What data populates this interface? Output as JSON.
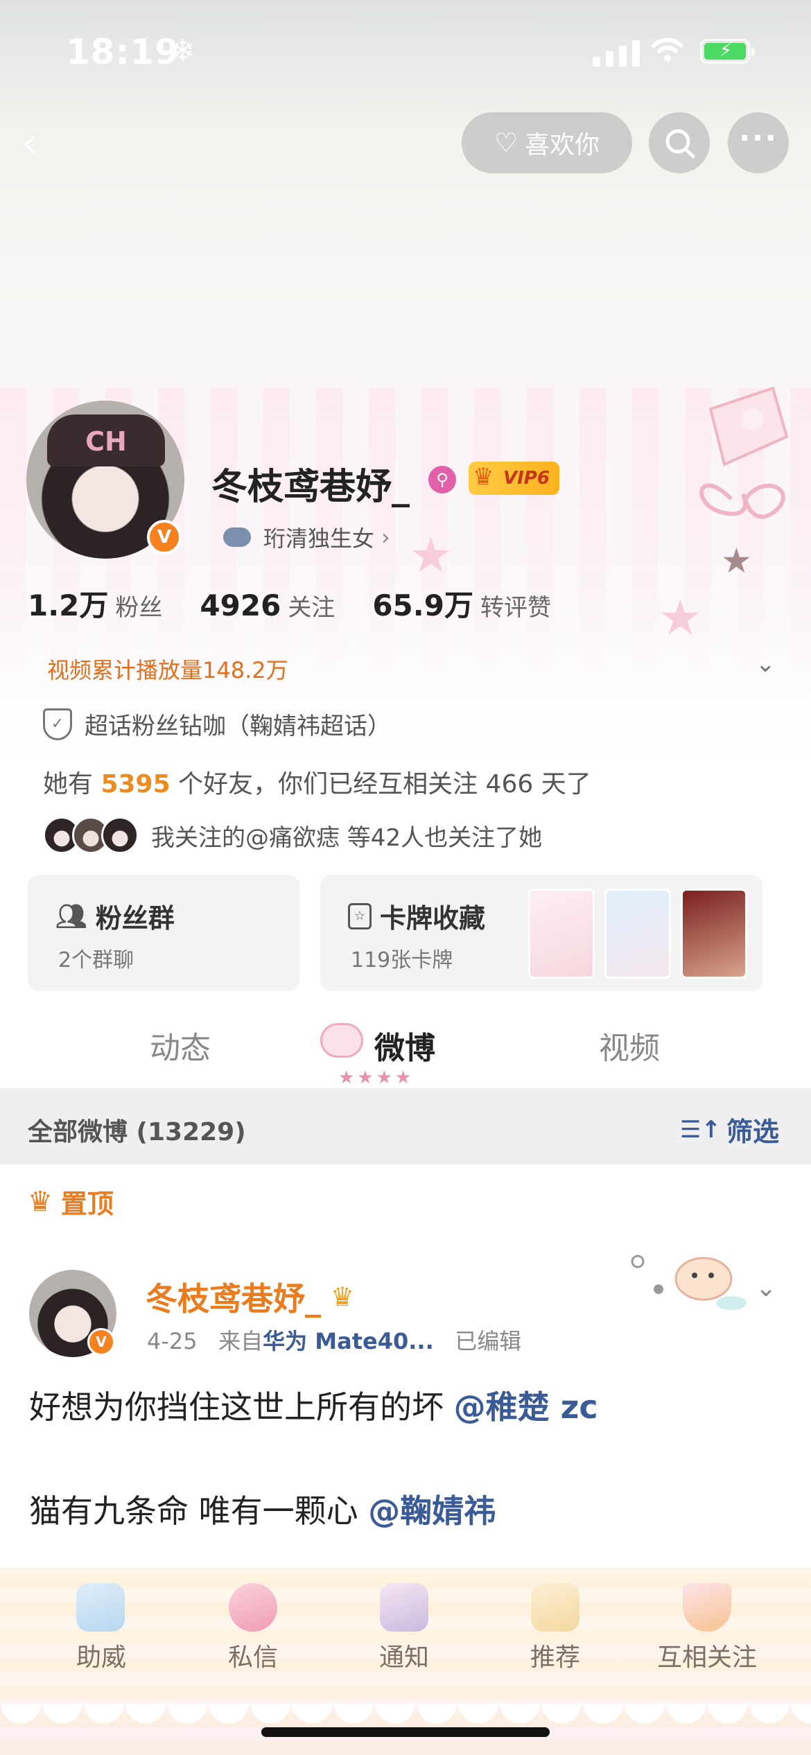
{
  "status_bar": {
    "time": "18:19",
    "weather_icon": "snowflake-icon"
  },
  "nav": {
    "like_label": "喜欢你"
  },
  "profile": {
    "name": "冬枝鸢巷妤_",
    "vip_label": "VIP6",
    "subtitle": "珩清独生女",
    "stats": [
      {
        "value": "1.2万",
        "label": "粉丝"
      },
      {
        "value": "4926",
        "label": "关注"
      },
      {
        "value": "65.9万",
        "label": "转评赞"
      }
    ],
    "play_count": "视频累计播放量148.2万",
    "super_topic": "超话粉丝钻咖（鞠婧祎超话）",
    "friends_prefix": "她有 ",
    "friends_count": "5395",
    "friends_suffix": " 个好友，你们已经互相关注 466 天了",
    "mutual_follow": "我关注的@痛欲痣 等42人也关注了她"
  },
  "cards": {
    "fan_group": {
      "title": "粉丝群",
      "sub": "2个群聊"
    },
    "card_collection": {
      "title": "卡牌收藏",
      "sub": "119张卡牌"
    }
  },
  "tabs": [
    "动态",
    "微博",
    "视频"
  ],
  "feed": {
    "all_label": "全部微博 (13229)",
    "filter_label": "筛选",
    "pinned_label": "置顶",
    "post": {
      "author": "冬枝鸢巷妤_",
      "date": "4-25",
      "from_prefix": "来自",
      "device": "华为 Mate40...",
      "edited": "已编辑",
      "line1_text": "好想为你挡住这世上所有的坏 ",
      "line1_mention": "@稚楚 zc",
      "line2_text": "猫有九条命 唯有一颗心 ",
      "line2_mention": "@鞠婧祎"
    }
  },
  "bottom_bar": [
    "助威",
    "私信",
    "通知",
    "推荐",
    "互相关注"
  ],
  "colors": {
    "accent_orange": "#ea7c1e",
    "link_blue": "#3b5b97",
    "vip_gold": "#ffb21e"
  }
}
